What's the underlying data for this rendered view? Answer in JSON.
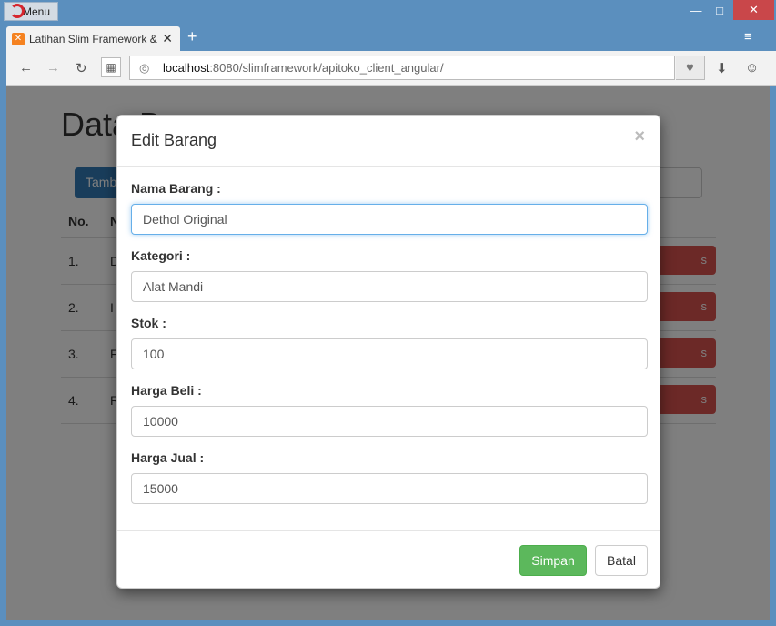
{
  "browser": {
    "menu_label": "Menu",
    "tab_title": "Latihan Slim Framework &",
    "address_host": "localhost",
    "address_rest": ":8080/slimframework/apitoko_client_angular/"
  },
  "page": {
    "title": "Data B",
    "add_button": "Tamb",
    "columns": {
      "no": "No.",
      "name": "N"
    },
    "rows": [
      {
        "no": "1.",
        "name": "D",
        "action": "s"
      },
      {
        "no": "2.",
        "name": "I",
        "action": "s"
      },
      {
        "no": "3.",
        "name": "F",
        "action": "s"
      },
      {
        "no": "4.",
        "name": "R",
        "action": "s"
      }
    ]
  },
  "modal": {
    "title": "Edit Barang",
    "close_symbol": "×",
    "fields": [
      {
        "label": "Nama Barang :",
        "value": "Dethol Original"
      },
      {
        "label": "Kategori :",
        "value": "Alat Mandi"
      },
      {
        "label": "Stok :",
        "value": "100"
      },
      {
        "label": "Harga Beli :",
        "value": "10000"
      },
      {
        "label": "Harga Jual :",
        "value": "15000"
      }
    ],
    "save_label": "Simpan",
    "cancel_label": "Batal"
  }
}
